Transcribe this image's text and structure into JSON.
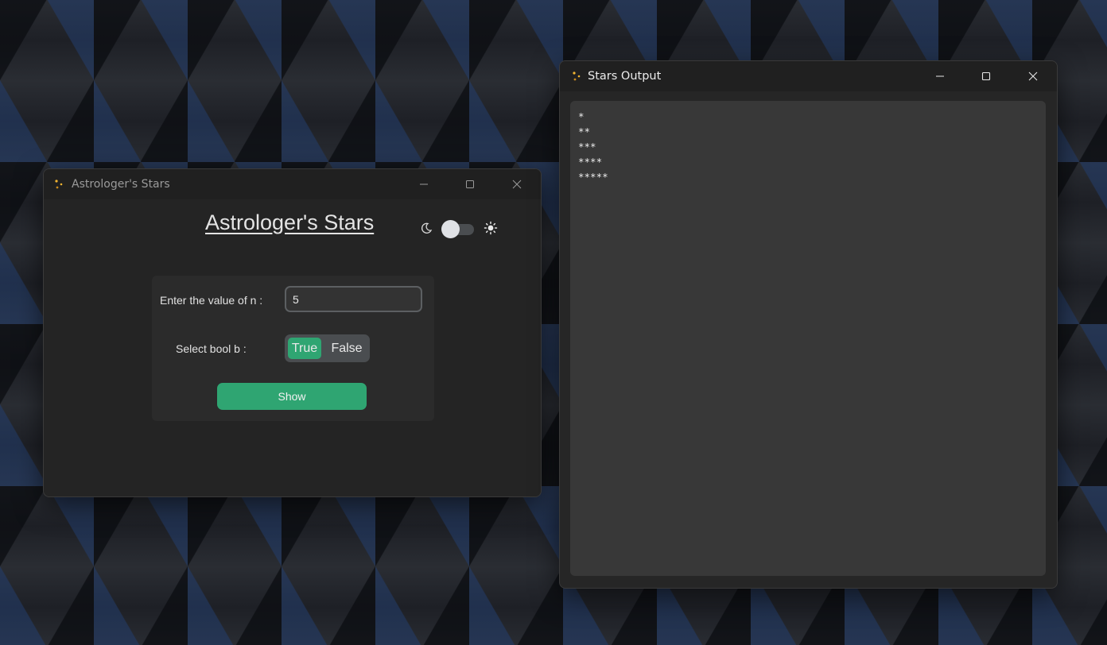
{
  "main_window": {
    "title": "Astrologer's Stars",
    "app_title": "Astrologer's Stars",
    "theme_switch": {
      "state": "dark"
    },
    "form": {
      "n_label": "Enter the value of n :",
      "n_value": "5",
      "bool_label": "Select bool b :",
      "bool_options": [
        "True",
        "False"
      ],
      "bool_selected": "True",
      "show_label": "Show"
    }
  },
  "output_window": {
    "title": "Stars Output",
    "lines": [
      "*",
      "**",
      "***",
      "****",
      "*****"
    ]
  },
  "icons": {
    "app": "sparkle-icon",
    "minimize": "minimize-icon",
    "maximize": "maximize-icon",
    "close": "close-icon",
    "dark_mode": "moon-icon",
    "light_mode": "sun-icon"
  },
  "colors": {
    "accent": "#2fa572",
    "window_bg": "#242424",
    "titlebar_bg": "#202020",
    "panel_bg": "#2b2b2b",
    "output_bg": "#383838"
  }
}
